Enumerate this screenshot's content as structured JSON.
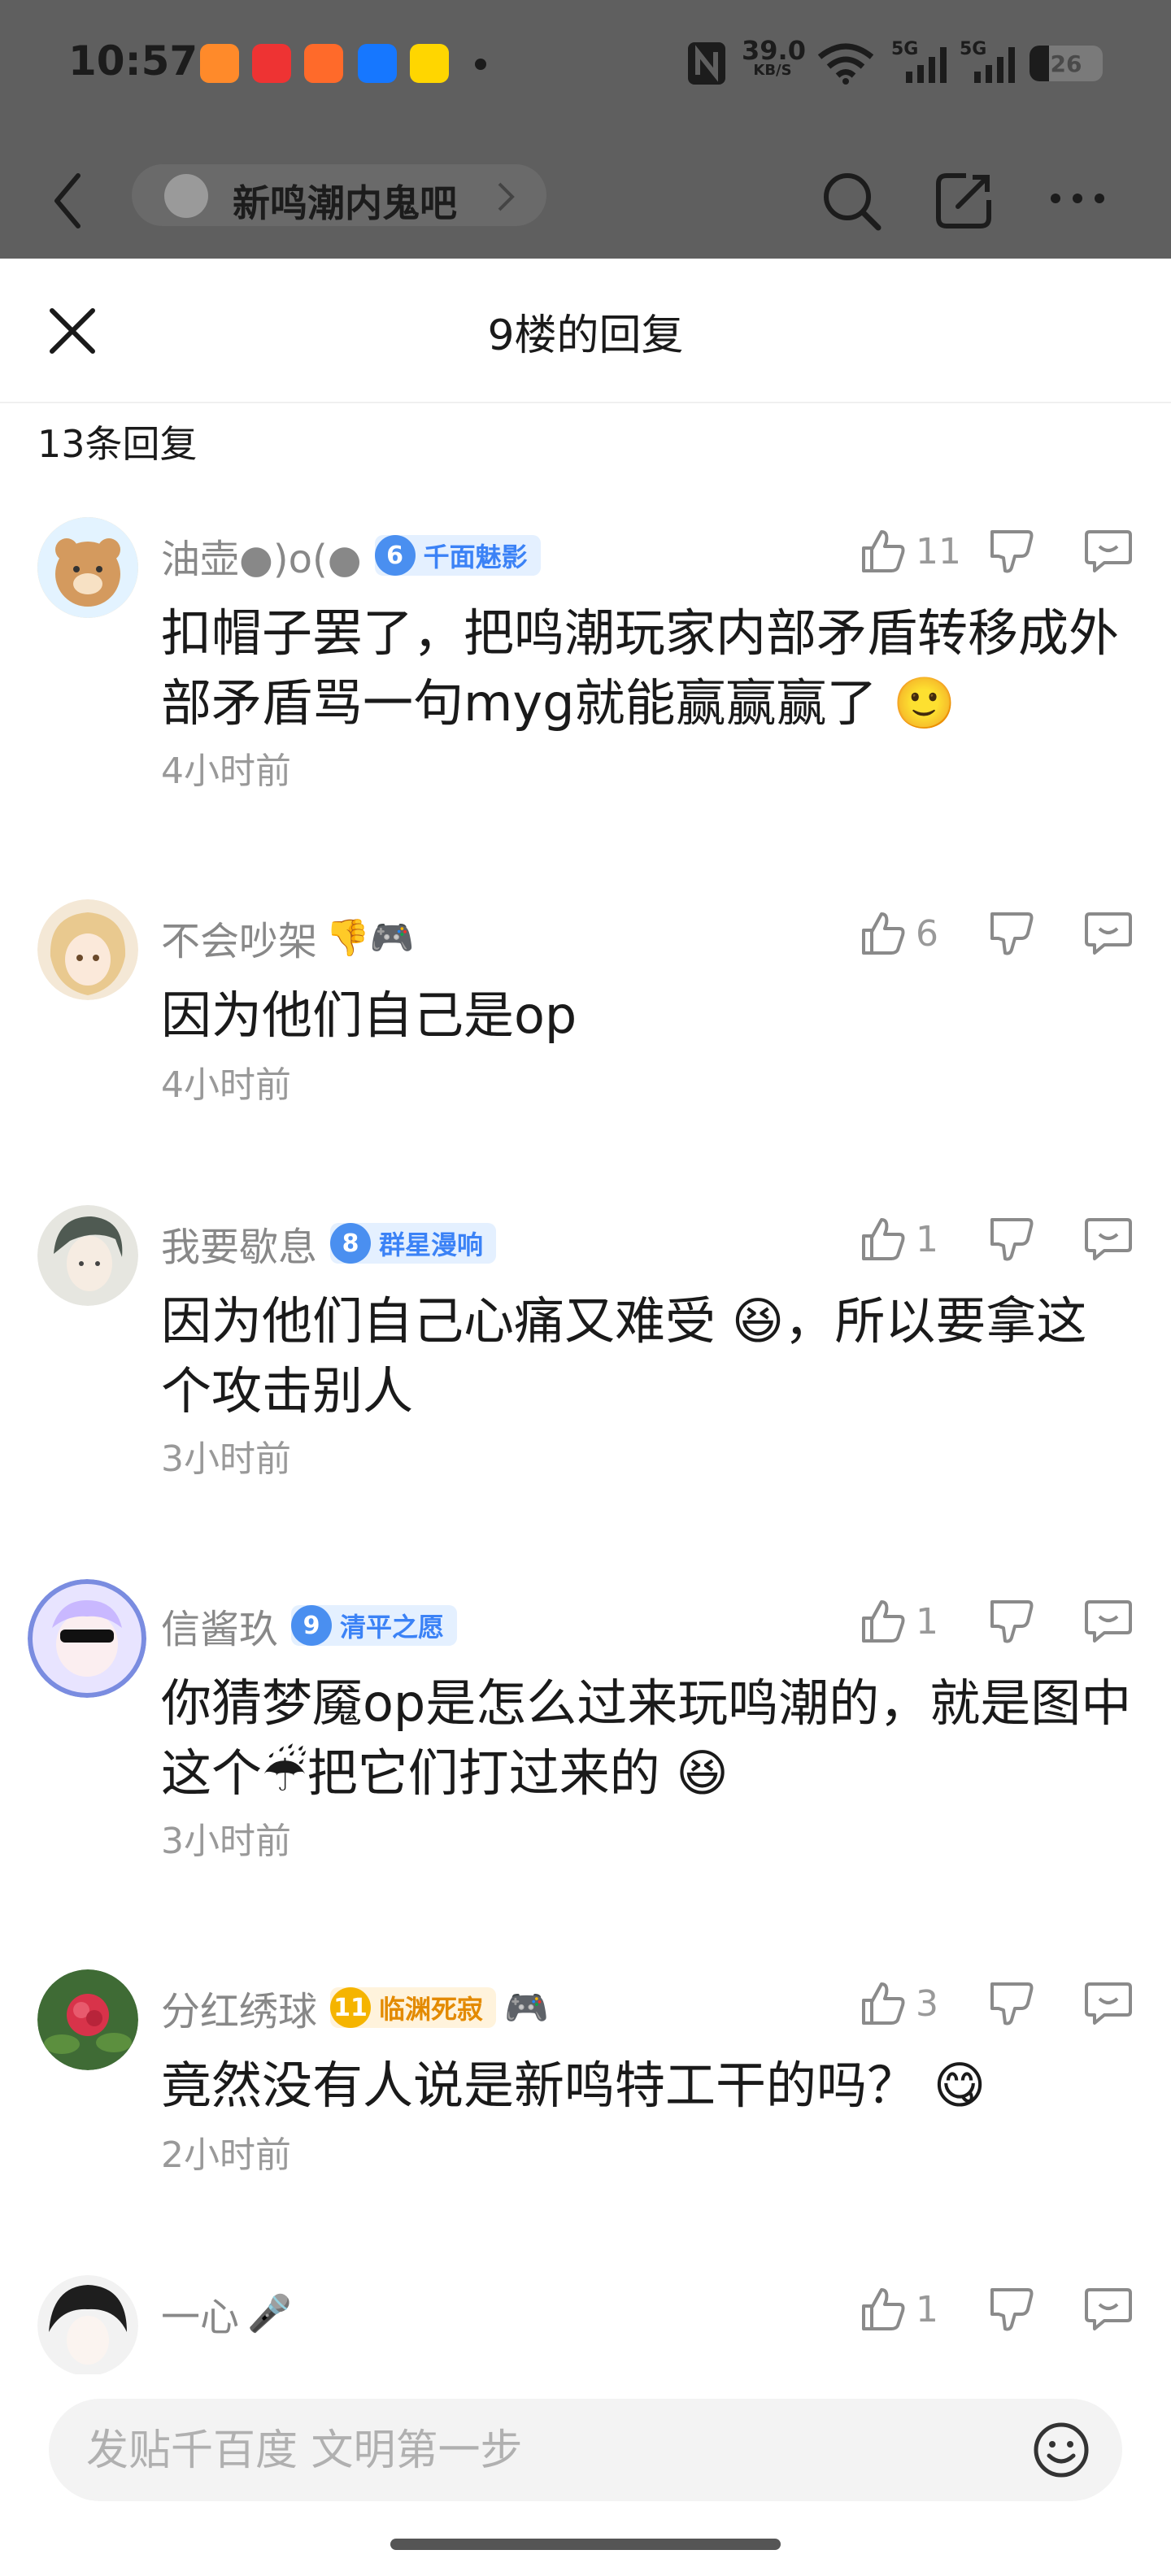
{
  "status_bar": {
    "time": "10:57",
    "net_speed": "39.0",
    "net_unit": "KB/S",
    "net_type_1": "5G",
    "net_type_2": "5G",
    "battery": "26",
    "app_icon_colors": [
      "#ff8a2a",
      "#ee3333",
      "#ff6a2a",
      "#1677ff",
      "#ffd600"
    ]
  },
  "nav": {
    "forum_name": "新鸣潮内鬼吧"
  },
  "sheet": {
    "title": "9楼的回复",
    "reply_count": "13条回复"
  },
  "replies": [
    {
      "username": "油壶●)o(●",
      "badge_level": "6",
      "badge_name": "千面魅影",
      "badge_style": "blue",
      "likes": "11",
      "text": "扣帽子罢了，把鸣潮玩家内部矛盾转移成外部矛盾骂一句myg就能赢赢赢了 🙂",
      "time": "4小时前"
    },
    {
      "username": "不会吵架",
      "name_emojis": "👎🎮",
      "likes": "6",
      "text": "因为他们自己是op",
      "time": "4小时前"
    },
    {
      "username": "我要歇息",
      "badge_level": "8",
      "badge_name": "群星漫响",
      "badge_style": "blue",
      "likes": "1",
      "text": "因为他们自己心痛又难受 😆，所以要拿这个攻击别人",
      "time": "3小时前"
    },
    {
      "username": "信酱玖",
      "badge_level": "9",
      "badge_name": "清平之愿",
      "badge_style": "blue",
      "likes": "1",
      "text": "你猜梦魇op是怎么过来玩鸣潮的，就是图中这个☔把它们打过来的 😆",
      "time": "3小时前"
    },
    {
      "username": "分红绣球",
      "badge_level": "11",
      "badge_name": "临渊死寂",
      "badge_style": "gold",
      "name_emojis": "🎮",
      "likes": "3",
      "text": "竟然没有人说是新鸣特工干的吗？ 😋",
      "time": "2小时前"
    },
    {
      "username": "一心",
      "name_emojis": "🎤",
      "likes": "1"
    }
  ],
  "input": {
    "placeholder": "发贴千百度 文明第一步"
  }
}
